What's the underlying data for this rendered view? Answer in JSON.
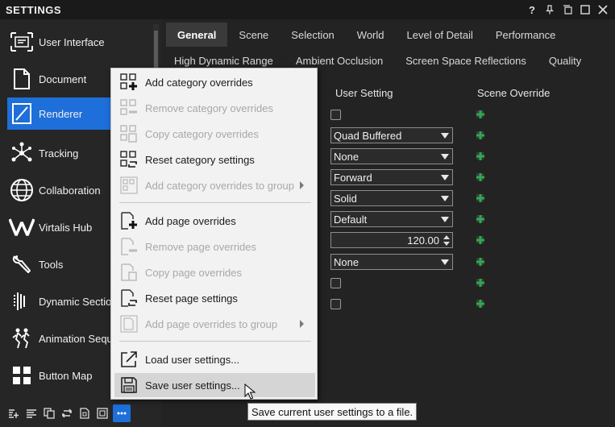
{
  "window": {
    "title": "SETTINGS",
    "controls": [
      "?",
      "pin",
      "restore",
      "maximize",
      "close"
    ]
  },
  "sidebar": {
    "items": [
      {
        "label": "User Interface",
        "icon": "user-interface-icon",
        "active": false
      },
      {
        "label": "Document",
        "icon": "document-icon",
        "active": false
      },
      {
        "label": "Renderer",
        "icon": "renderer-icon",
        "active": true
      },
      {
        "label": "Tracking",
        "icon": "tracking-icon",
        "active": false
      },
      {
        "label": "Collaboration",
        "icon": "collaboration-icon",
        "active": false
      },
      {
        "label": "Virtalis Hub",
        "icon": "virtalis-hub-icon",
        "active": false
      },
      {
        "label": "Tools",
        "icon": "tools-icon",
        "active": false
      },
      {
        "label": "Dynamic Sectio",
        "icon": "dynamic-section-icon",
        "active": false
      },
      {
        "label": "Animation Sequ",
        "icon": "animation-sequence-icon",
        "active": false
      },
      {
        "label": "Button Map",
        "icon": "button-map-icon",
        "active": false
      }
    ]
  },
  "bottom_toolbar": {
    "buttons": [
      "add-icon",
      "list-icon",
      "copy-icon",
      "reset-icon",
      "page-icon",
      "frame-icon",
      "more-icon"
    ]
  },
  "tabs_row1": [
    "General",
    "Scene",
    "Selection",
    "World",
    "Level of Detail",
    "Performance"
  ],
  "tabs_row2": [
    "High Dynamic Range",
    "Ambient Occlusion",
    "Screen Space Reflections",
    "Quality"
  ],
  "active_tab": "General",
  "columns": {
    "user_setting": "User Setting",
    "scene_override": "Scene Override"
  },
  "settings_rows": [
    {
      "type": "checkbox",
      "checked": false
    },
    {
      "type": "select",
      "value": "Quad Buffered"
    },
    {
      "type": "select",
      "value": "None"
    },
    {
      "type": "select",
      "value": "Forward"
    },
    {
      "type": "select",
      "value": "Solid"
    },
    {
      "type": "select",
      "value": "Default"
    },
    {
      "type": "spin",
      "value": "120.00"
    },
    {
      "type": "select",
      "value": "None"
    },
    {
      "type": "checkbox",
      "checked": false
    },
    {
      "type": "checkbox",
      "checked": false
    }
  ],
  "context_menu": {
    "items": [
      {
        "label": "Add category overrides",
        "enabled": true,
        "icon": "add-category-icon"
      },
      {
        "label": "Remove category overrides",
        "enabled": false,
        "icon": "remove-category-icon"
      },
      {
        "label": "Copy category overrides",
        "enabled": false,
        "icon": "copy-category-icon"
      },
      {
        "label": "Reset category settings",
        "enabled": true,
        "icon": "reset-category-icon"
      },
      {
        "label": "Add category overrides to group",
        "enabled": false,
        "icon": "add-category-group-icon",
        "submenu": true
      },
      {
        "label": "Add page overrides",
        "enabled": true,
        "icon": "add-page-icon"
      },
      {
        "label": "Remove page overrides",
        "enabled": false,
        "icon": "remove-page-icon"
      },
      {
        "label": "Copy page overrides",
        "enabled": false,
        "icon": "copy-page-icon"
      },
      {
        "label": "Reset page settings",
        "enabled": true,
        "icon": "reset-page-icon"
      },
      {
        "label": "Add page overrides to group",
        "enabled": false,
        "icon": "add-page-group-icon",
        "submenu": true
      },
      {
        "label": "Load user settings...",
        "enabled": true,
        "icon": "load-icon"
      },
      {
        "label": "Save user settings...",
        "enabled": true,
        "icon": "save-icon",
        "hover": true
      }
    ]
  },
  "tooltip": "Save current user settings to a file.",
  "colors": {
    "accent": "#1e6fd9",
    "override_icon": "#2fa84f"
  }
}
